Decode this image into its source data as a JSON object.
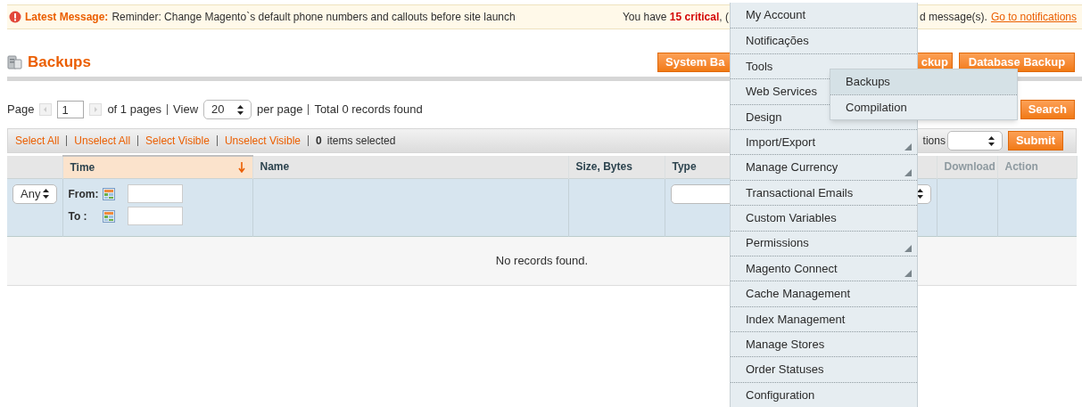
{
  "notice": {
    "label": "Latest Message:",
    "text": "Reminder: Change Magento`s default phone numbers and callouts before site launch",
    "status_before": "You have **15 critical**, (",
    "status_after": "d message(s).",
    "link": "Go to notifications"
  },
  "page": {
    "title": "Backups",
    "buttons": [
      {
        "label": "System Ba"
      },
      {
        "label": "ckup"
      },
      {
        "label": "Database Backup"
      }
    ]
  },
  "pager": {
    "page_label": "Page",
    "page_value": "1",
    "of_pages": "of 1 pages",
    "view_label": "View",
    "per_page_value": "20",
    "per_page_label": "per page",
    "total": "Total 0 records found",
    "search_button": "Search"
  },
  "massaction": {
    "links": [
      "Select All",
      "Unselect All",
      "Select Visible",
      "Unselect Visible"
    ],
    "count": "0",
    "count_label": "items selected",
    "actions_label": "tions",
    "submit": "Submit"
  },
  "grid": {
    "columns": [
      {
        "label": "Time",
        "sortable": true,
        "sorted": true
      },
      {
        "label": "Name",
        "sortable": true,
        "sorted": false
      },
      {
        "label": "Size, Bytes",
        "sortable": true,
        "sorted": false
      },
      {
        "label": "Type",
        "sortable": true,
        "sorted": false
      },
      {
        "label": "Download",
        "sortable": false,
        "sorted": false
      },
      {
        "label": "Action",
        "sortable": false,
        "sorted": false
      }
    ],
    "filters": {
      "any_value": "Any",
      "from_label": "From:",
      "to_label": "To :"
    },
    "empty_message": "No records found."
  },
  "menu": {
    "items": [
      {
        "label": "My Account",
        "corner_mark": false
      },
      {
        "label": "Notificações",
        "corner_mark": false
      },
      {
        "label": "Tools"
      },
      {
        "label": "Web Services"
      },
      {
        "label": "Design",
        "corner_mark": false
      },
      {
        "label": "Import/Export",
        "corner_mark": true
      },
      {
        "label": "Manage Currency",
        "corner_mark": true
      },
      {
        "label": "Transactional Emails",
        "corner_mark": false
      },
      {
        "label": "Custom Variables",
        "corner_mark": false
      },
      {
        "label": "Permissions",
        "corner_mark": true
      },
      {
        "label": "Magento Connect",
        "corner_mark": true
      },
      {
        "label": "Cache Management",
        "corner_mark": false
      },
      {
        "label": "Index Management",
        "corner_mark": false
      },
      {
        "label": "Manage Stores",
        "corner_mark": false
      },
      {
        "label": "Order Statuses",
        "corner_mark": false
      },
      {
        "label": "Configuration",
        "corner_mark": false
      }
    ],
    "submenu": [
      {
        "label": "Backups",
        "selected": true
      },
      {
        "label": "Compilation",
        "selected": false
      }
    ]
  }
}
